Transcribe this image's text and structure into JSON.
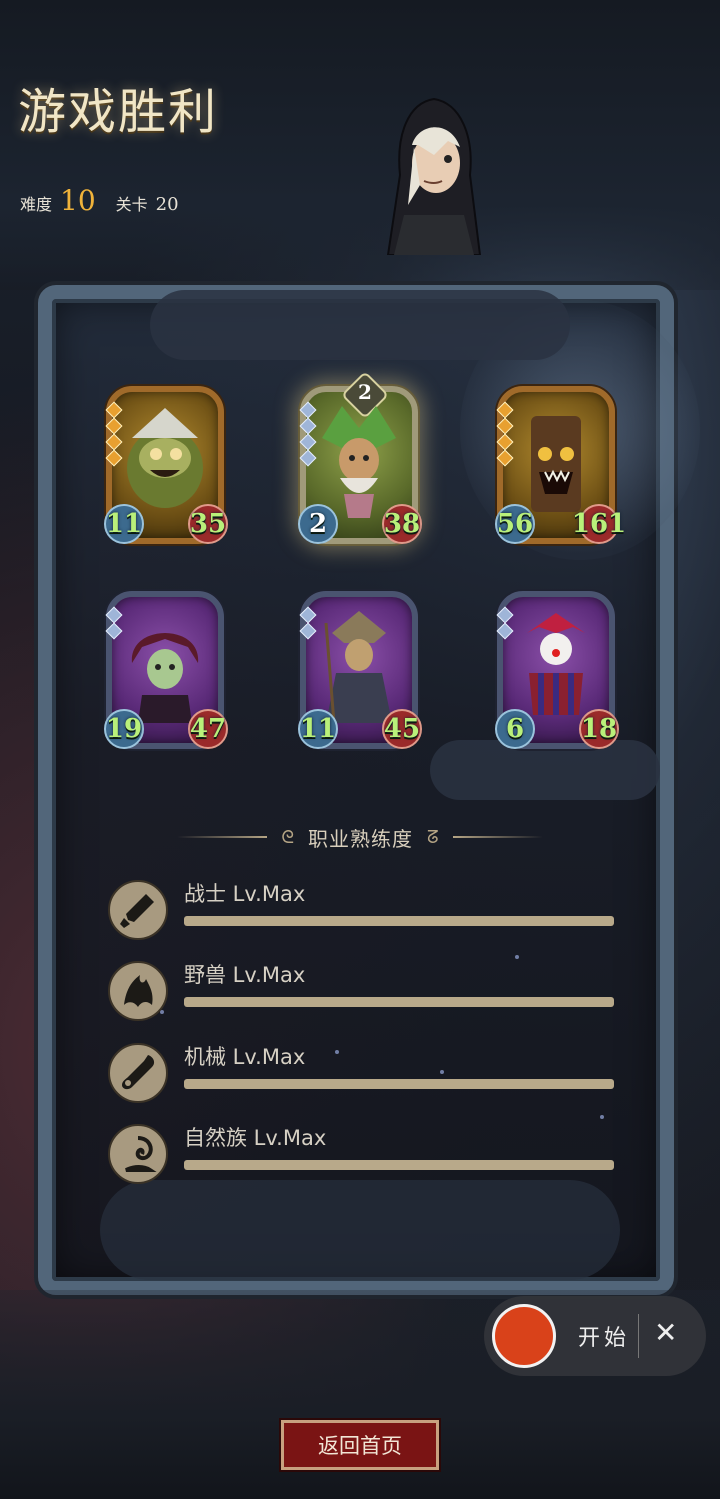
{
  "header": {
    "title": "游戏胜利",
    "difficulty_label": "难度",
    "difficulty_value": "10",
    "stage_label": "关卡",
    "stage_value": "20"
  },
  "cards": [
    {
      "attack": "11",
      "health": "35",
      "frame": "gold",
      "pips": 4
    },
    {
      "attack": "2",
      "health": "38",
      "frame": "green",
      "pips": 4,
      "top_badge": "2"
    },
    {
      "attack": "56",
      "health": "161",
      "frame": "gold",
      "pips": 4
    },
    {
      "attack": "19",
      "health": "47",
      "frame": "purple",
      "pips": 2
    },
    {
      "attack": "11",
      "health": "45",
      "frame": "purple",
      "pips": 2
    },
    {
      "attack": "6",
      "health": "18",
      "frame": "purple",
      "pips": 2
    }
  ],
  "mastery": {
    "title": "职业熟练度",
    "rows": [
      {
        "label": "战士 Lv.Max",
        "icon": "sword-icon",
        "progress": 1.0
      },
      {
        "label": "野兽 Lv.Max",
        "icon": "beast-claw-icon",
        "progress": 1.0
      },
      {
        "label": "机械 Lv.Max",
        "icon": "wrench-icon",
        "progress": 1.0
      },
      {
        "label": "自然族 Lv.Max",
        "icon": "swirl-nature-icon",
        "progress": 1.0
      }
    ]
  },
  "footer": {
    "return_label": "返回首页"
  },
  "recorder": {
    "start_label": "开始",
    "close_symbol": "✕"
  },
  "colors": {
    "title": "#f1e6c6",
    "difficulty": "#f0b33a",
    "stat_green": "#b9f07a",
    "return_button": "#7a1414",
    "record_dot": "#d9421a"
  }
}
